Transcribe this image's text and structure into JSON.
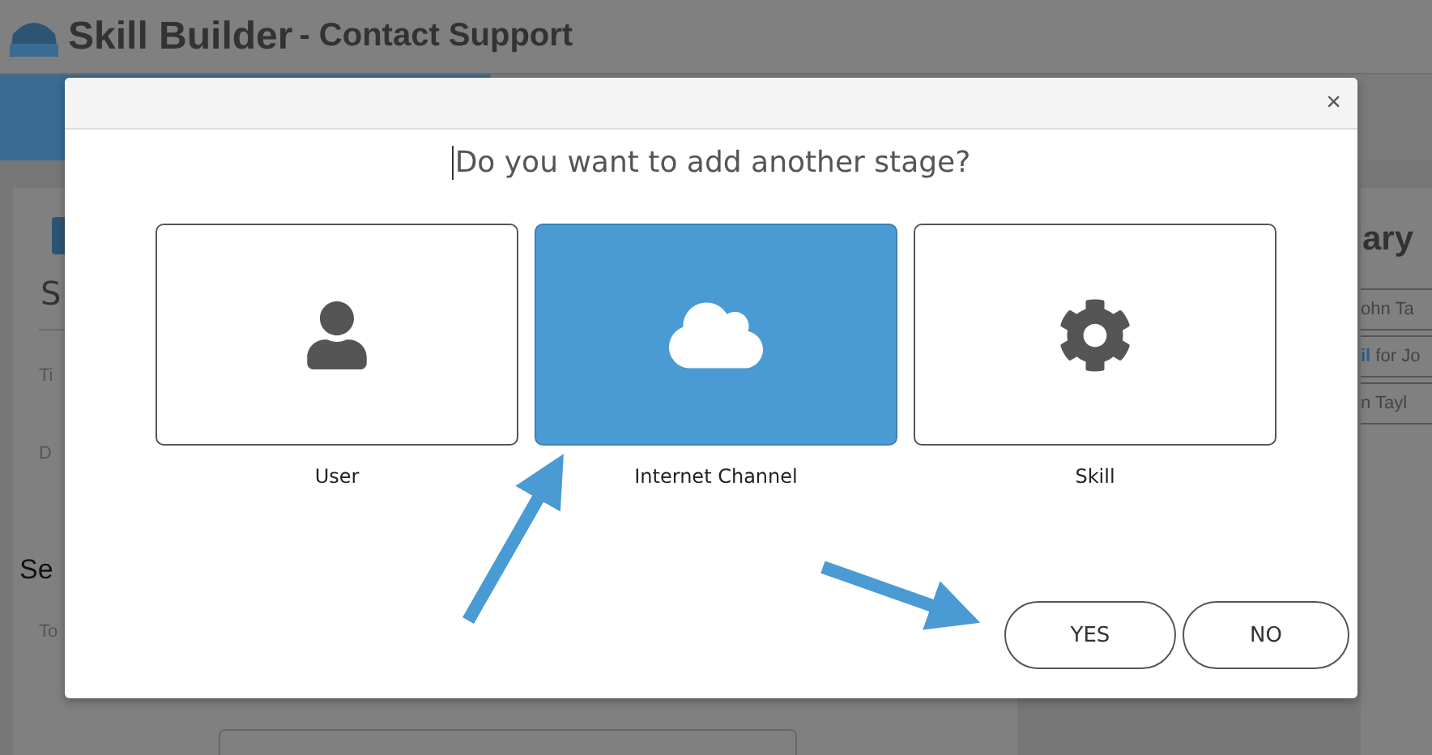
{
  "background": {
    "title": "Skill Builder",
    "subtitle": "- Contact Support",
    "section_letter": "S",
    "fields": [
      {
        "label": "Ti"
      },
      {
        "label": "D"
      }
    ],
    "section_heading": "Se",
    "section_fields": [
      {
        "label": "To"
      }
    ],
    "summary_heading": "ary",
    "summary_rows": [
      "ohn Ta",
      "**il** for Jo",
      "n Tayl"
    ]
  },
  "dialog": {
    "question": "Do you want to add another stage?",
    "close": "×",
    "options": [
      {
        "kind": "user",
        "label": "User",
        "selected": false
      },
      {
        "kind": "cloud",
        "label": "Internet Channel",
        "selected": true
      },
      {
        "kind": "gear",
        "label": "Skill",
        "selected": false
      }
    ],
    "buttons": [
      "YES",
      "NO"
    ]
  }
}
